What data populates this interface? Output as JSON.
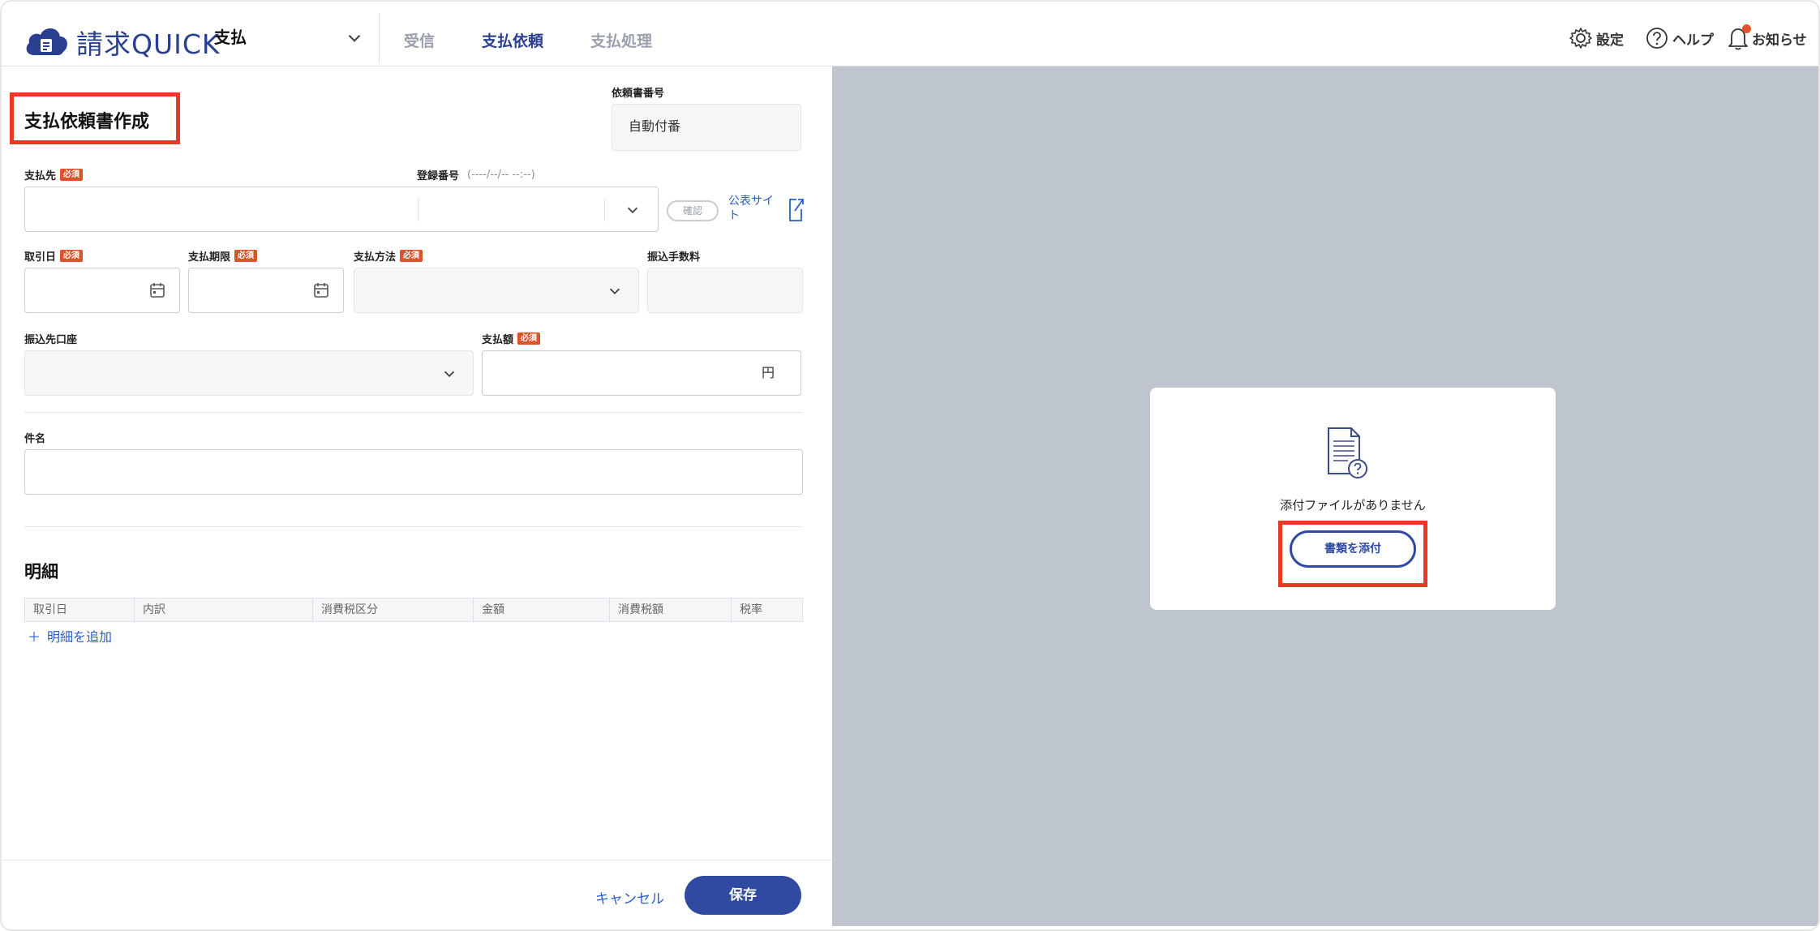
{
  "header": {
    "brand": "請求QUICK",
    "module": "支払",
    "nav": [
      {
        "label": "受信",
        "active": false
      },
      {
        "label": "支払依頼",
        "active": true
      },
      {
        "label": "支払処理",
        "active": false
      }
    ],
    "settings_label": "設定",
    "help_label": "ヘルプ",
    "notice_label": "お知らせ"
  },
  "form": {
    "title": "支払依頼書作成",
    "doc_number_label": "依頼書番号",
    "doc_number_value": "自動付番",
    "payee_label": "支払先",
    "required_badge": "必須",
    "reg_no_label": "登録番号",
    "reg_no_hint": "(----/--/-- --:--)",
    "confirm_label": "確認",
    "public_site_label": "公表サイト",
    "transaction_date_label": "取引日",
    "due_date_label": "支払期限",
    "payment_method_label": "支払方法",
    "transfer_fee_label": "振込手数料",
    "transfer_account_label": "振込先口座",
    "amount_label": "支払額",
    "amount_unit": "円",
    "subject_label": "件名"
  },
  "details": {
    "title": "明細",
    "columns": [
      "取引日",
      "内訳",
      "消費税区分",
      "金額",
      "消費税額",
      "税率"
    ],
    "add_label": "明細を追加"
  },
  "footer": {
    "cancel_label": "キャンセル",
    "save_label": "保存"
  },
  "attachment": {
    "empty_text": "添付ファイルがありません",
    "attach_label": "書類を添付"
  },
  "colors": {
    "brand": "#2a3f8f",
    "primary_button": "#2f4aa0",
    "required_badge": "#d9532b",
    "highlight": "#e53a26",
    "preview_bg": "#bfc5cf"
  }
}
